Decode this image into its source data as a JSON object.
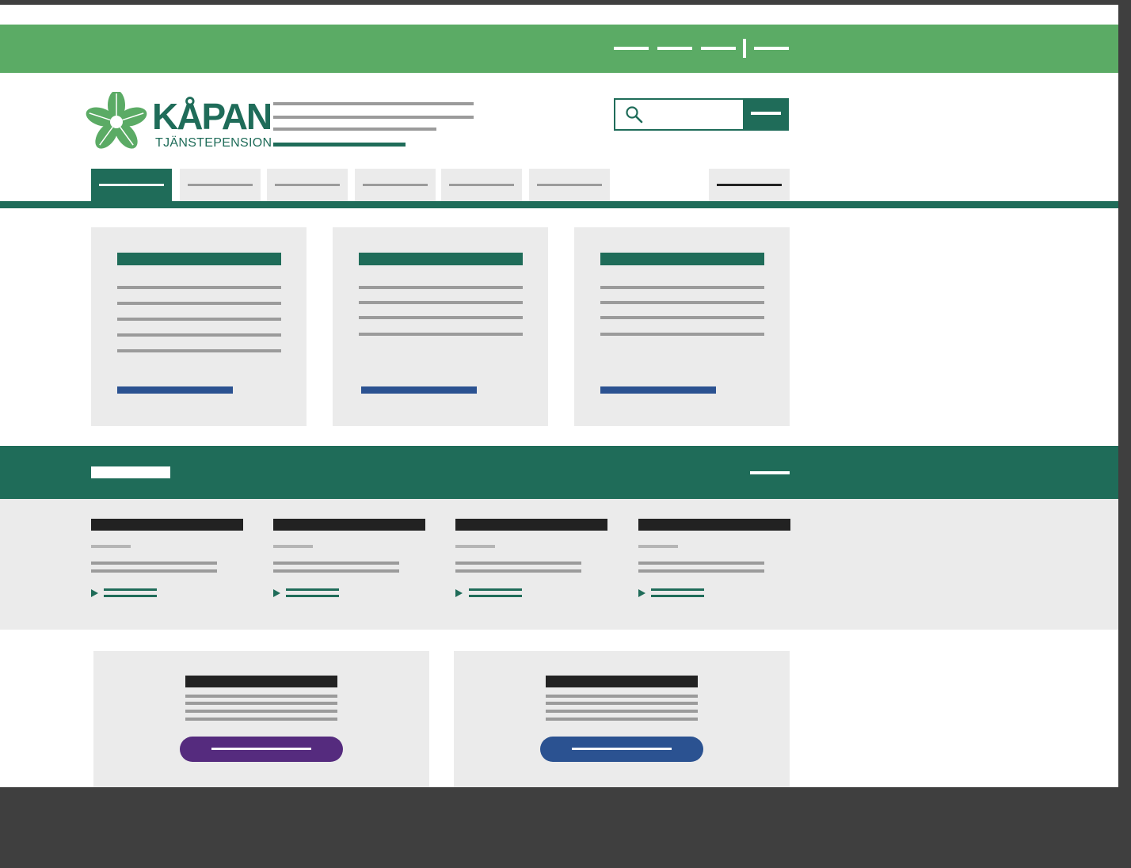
{
  "colors": {
    "frame": "#3f3f3f",
    "brand_green": "#5bab65",
    "dark_green": "#1f6c59",
    "card_gray": "#ebebeb",
    "placeholder_gray": "#9b9b9b",
    "text_black": "#222222",
    "link_blue": "#2b5291",
    "purple": "#552b7e",
    "white": "#ffffff"
  },
  "brand": {
    "name": "KÅPAN",
    "tagline": "TJÄNSTEPENSION"
  },
  "icons": {
    "logo": "flower-logo-icon",
    "search": "magnifier-icon",
    "news_arrow": "triangle-right-icon"
  },
  "wireframe": {
    "utility_links": 4,
    "nav_tabs": 6,
    "active_tab_index": 0,
    "feature_cards": 3,
    "news_items": 4,
    "promo_boxes": 2
  }
}
